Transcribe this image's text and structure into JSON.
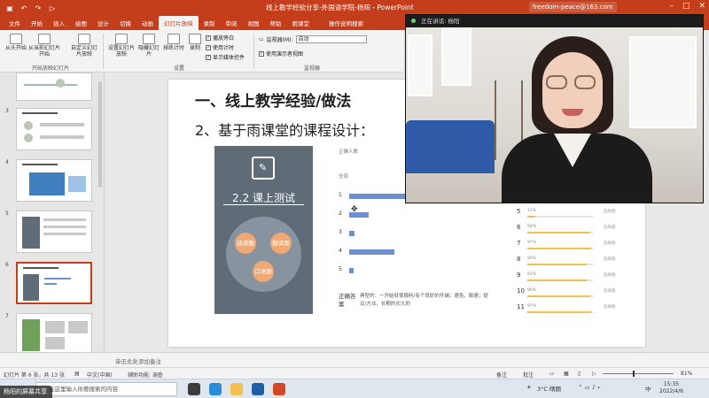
{
  "titlebar": {
    "doc_title": "线上教学经验分享-外国语学院-杨阳 - PowerPoint",
    "account": "freedom-peace@163.com"
  },
  "ribbon_tabs": [
    "文件",
    "开始",
    "插入",
    "绘图",
    "设计",
    "切换",
    "动画",
    "幻灯片放映",
    "录制",
    "审阅",
    "视图",
    "帮助",
    "雨课堂",
    "操作说明搜索"
  ],
  "ribbon": {
    "from_beginning": "从头开始",
    "from_current": "从当前幻灯片开始",
    "custom_show": "自定义幻灯片放映",
    "start_group": "开始放映幻灯片",
    "setup_show": "设置幻灯片放映",
    "hide_slide": "隐藏幻灯片",
    "rehearse": "排练计时",
    "record": "录制",
    "setup_group": "设置",
    "cb_play_narration": "播放旁白",
    "cb_use_timings": "使用计时",
    "cb_show_media": "显示媒体控件",
    "monitor_label": "监视器(M):",
    "monitor_value": "自动",
    "presenter_view": "使用演示者视图",
    "monitors_group": "监视器"
  },
  "thumbnails": [
    {
      "num": "",
      "active": false
    },
    {
      "num": "3",
      "active": false
    },
    {
      "num": "4",
      "active": false
    },
    {
      "num": "5",
      "active": false
    },
    {
      "num": "6",
      "active": true
    },
    {
      "num": "7",
      "active": false
    }
  ],
  "slide": {
    "title": "一、线上教学经验/做法",
    "subtitle": "2、基于雨课堂的课程设计：",
    "panel_label": "2.2 课上测试",
    "segments": [
      "选择题",
      "翻译题",
      "口语题"
    ],
    "correct_label": "正确人数",
    "all_label": "全部",
    "question_bars": [
      {
        "num": "1",
        "value": 0.48
      },
      {
        "num": "2",
        "value": 0.14
      },
      {
        "num": "3",
        "value": 0.04
      },
      {
        "num": "4",
        "value": 0.32
      },
      {
        "num": "5",
        "value": 0.03
      }
    ],
    "answer_label": "正确答案",
    "answer_text": "典型的：一开始就很顺利/有个良好的开端；避免、歇避；提议/方法，长期的长久的",
    "results": [
      {
        "num": "5",
        "pct": "12%",
        "value": 0.12,
        "tag": "选择题"
      },
      {
        "num": "6",
        "pct": "94%",
        "value": 0.94,
        "tag": "选择题"
      },
      {
        "num": "7",
        "pct": "97%",
        "value": 0.97,
        "tag": "选择题"
      },
      {
        "num": "8",
        "pct": "90%",
        "value": 0.9,
        "tag": "选择题"
      },
      {
        "num": "9",
        "pct": "91%",
        "value": 0.91,
        "tag": "选择题"
      },
      {
        "num": "10",
        "pct": "96%",
        "value": 0.96,
        "tag": "选择题"
      },
      {
        "num": "11",
        "pct": "97%",
        "value": 0.97,
        "tag": "选择题"
      }
    ]
  },
  "notes_placeholder": "单击此处添加备注",
  "status": {
    "slide_info": "幻灯片 第 6 张，共 13 张",
    "language": "中文(中国)",
    "accessibility": "辅助功能: 调查",
    "notes": "备注",
    "comments": "批注",
    "zoom": "81%"
  },
  "taskbar": {
    "search_placeholder": "在这里输入你要搜索的内容",
    "weather": "3°C 晴朗",
    "time": "15:35",
    "date": "2022/4/6"
  },
  "screenshare_label": "杨阳的屏幕共享",
  "video": {
    "header": "正在讲话: 杨阳",
    "speaker": "杨阳"
  }
}
